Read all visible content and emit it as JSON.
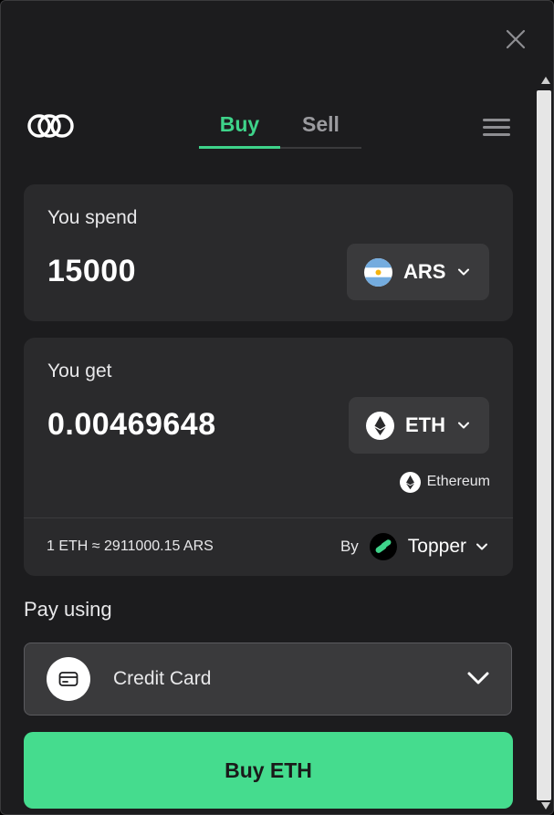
{
  "tabs": {
    "buy_label": "Buy",
    "sell_label": "Sell"
  },
  "spend": {
    "label": "You spend",
    "amount": "15000",
    "currency": "ARS",
    "currency_icon": "argentina-flag-icon"
  },
  "get": {
    "label": "You get",
    "amount": "0.00469648",
    "currency": "ETH",
    "currency_icon": "ethereum-icon",
    "network": "Ethereum",
    "rate": "1 ETH ≈ 2911000.15 ARS",
    "by_label": "By",
    "provider": "Topper"
  },
  "payment": {
    "label": "Pay using",
    "method": "Credit Card",
    "method_icon": "credit-card-icon"
  },
  "cta": {
    "label": "Buy ETH"
  },
  "colors": {
    "accent": "#3ed38a",
    "button": "#45dc8e",
    "background": "#1c1c1e",
    "card": "#2a2a2c"
  }
}
